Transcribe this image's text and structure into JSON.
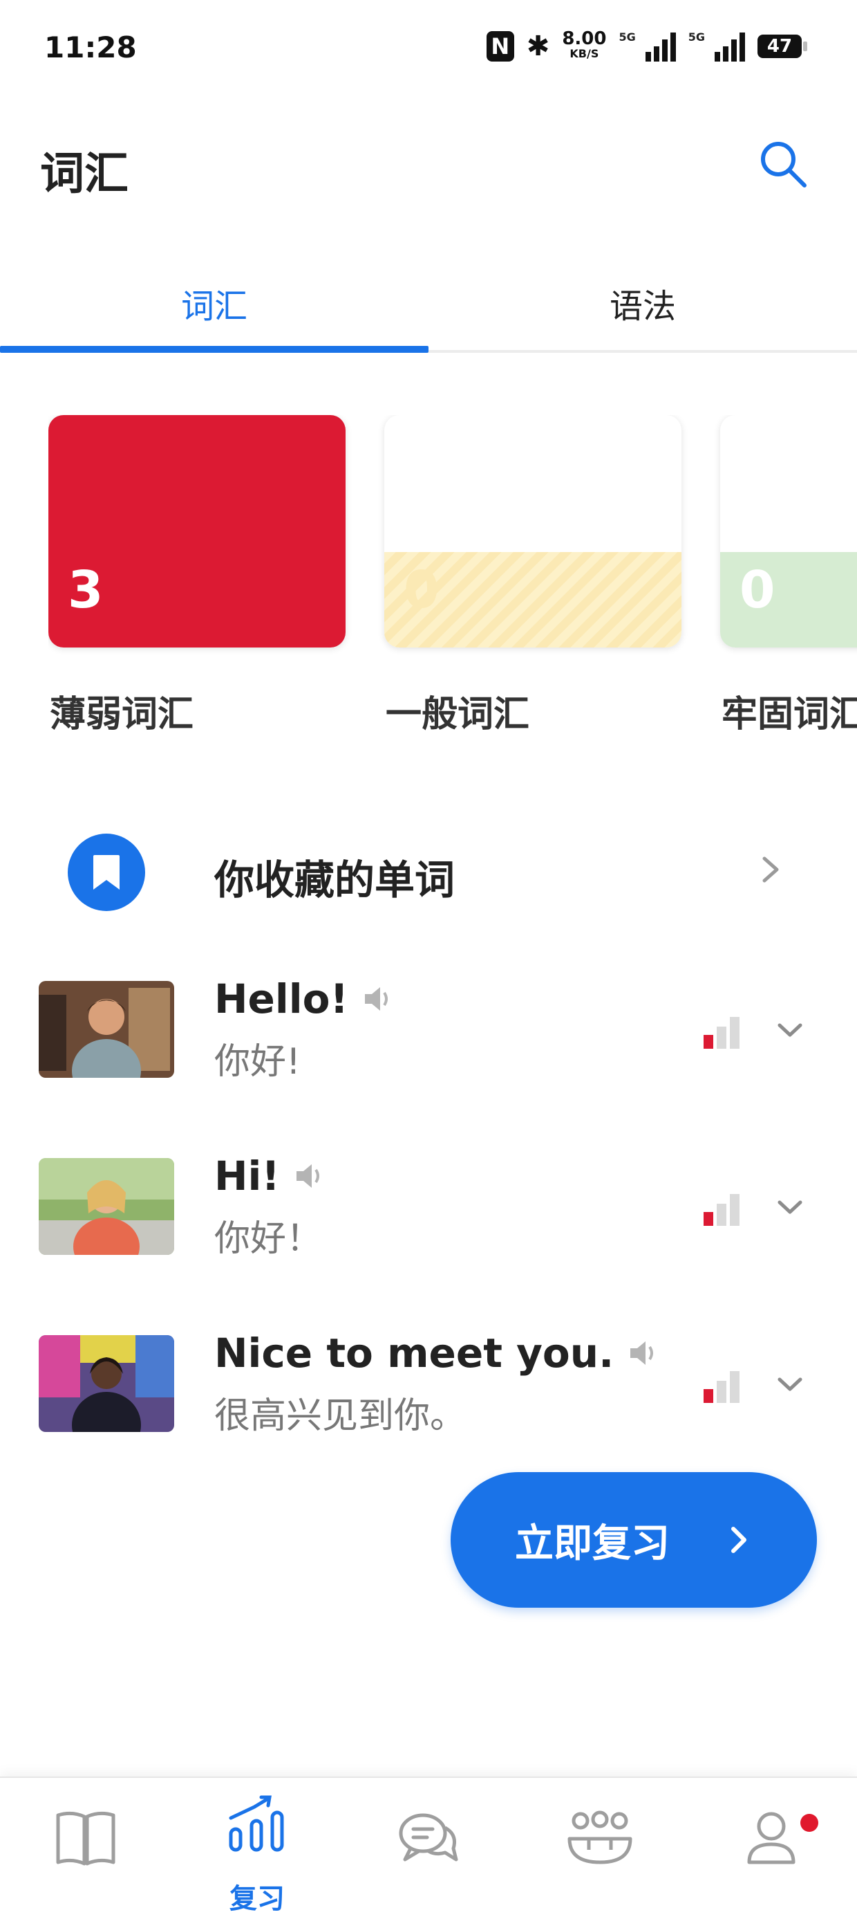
{
  "status_bar": {
    "time": "11:28",
    "net_speed": "8.00",
    "net_unit": "KB/S",
    "network_1": "5G",
    "network_2": "5G",
    "battery": "47"
  },
  "header": {
    "title": "词汇",
    "search_icon": "search-icon"
  },
  "tabs": [
    {
      "label": "词汇",
      "active": true
    },
    {
      "label": "语法",
      "active": false
    }
  ],
  "strength_cards": [
    {
      "count": "3",
      "label": "薄弱词汇",
      "color": "#dc1a33",
      "fill": 1.0
    },
    {
      "count": "0",
      "label": "一般词汇",
      "color": "#fdf1c8",
      "fill": 0.4
    },
    {
      "count": "0",
      "label": "牢固词汇",
      "color": "#d6ecd2",
      "fill": 0.4
    }
  ],
  "saved_words": {
    "label": "你收藏的单词",
    "icon": "bookmark-icon"
  },
  "vocab_items": [
    {
      "word": "Hello!",
      "translation": "你好!",
      "strength": "weak"
    },
    {
      "word": "Hi!",
      "translation": "你好！",
      "strength": "weak"
    },
    {
      "word": "Nice to meet you.",
      "translation": "很高兴见到你。",
      "strength": "weak"
    }
  ],
  "review_button": {
    "label": "立即复习"
  },
  "bottom_nav": [
    {
      "name": "courses",
      "icon": "book-icon",
      "label": ""
    },
    {
      "name": "review",
      "icon": "chart-icon",
      "label": "复习",
      "active": true
    },
    {
      "name": "chat",
      "icon": "chat-icon",
      "label": ""
    },
    {
      "name": "community",
      "icon": "community-icon",
      "label": ""
    },
    {
      "name": "profile",
      "icon": "profile-icon",
      "label": "",
      "badge": true
    }
  ],
  "colors": {
    "accent": "#1a73e8",
    "weak": "#dc1a33",
    "medium": "#fdf1c8",
    "strong": "#d6ecd2"
  }
}
